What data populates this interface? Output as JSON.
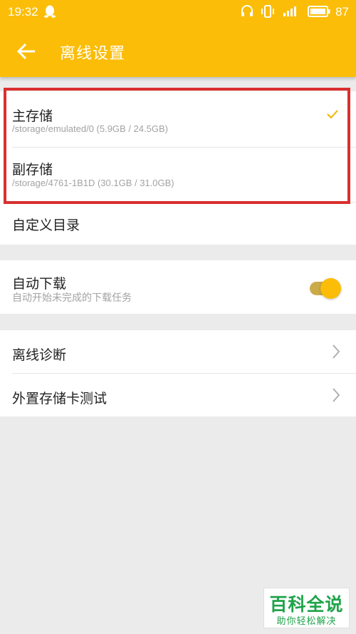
{
  "status_bar": {
    "time": "19:32",
    "battery": "87",
    "icons": [
      "qq-penguin-icon",
      "headset-icon",
      "vibrate-icon",
      "signal-icon",
      "battery-icon"
    ]
  },
  "header": {
    "title": "离线设置",
    "back_icon": "arrow-left-icon",
    "background_color": "#fbbd08"
  },
  "storage": {
    "primary": {
      "title": "主存储",
      "path": "/storage/emulated/0 (5.9GB / 24.5GB)",
      "selected": true
    },
    "secondary": {
      "title": "副存储",
      "path": "/storage/4761-1B1D (30.1GB / 31.0GB)",
      "selected": false
    },
    "custom_dir": {
      "title": "自定义目录"
    }
  },
  "auto_download": {
    "title": "自动下载",
    "subtitle": "自动开始未完成的下载任务",
    "enabled": true
  },
  "tools": {
    "diagnose": {
      "title": "离线诊断"
    },
    "sd_test": {
      "title": "外置存储卡测试"
    }
  },
  "watermark": {
    "main": "百科全说",
    "sub": "助你轻松解决"
  },
  "colors": {
    "accent": "#fbbd08",
    "highlight_border": "#d92f2f",
    "watermark_green": "#1fa349"
  }
}
